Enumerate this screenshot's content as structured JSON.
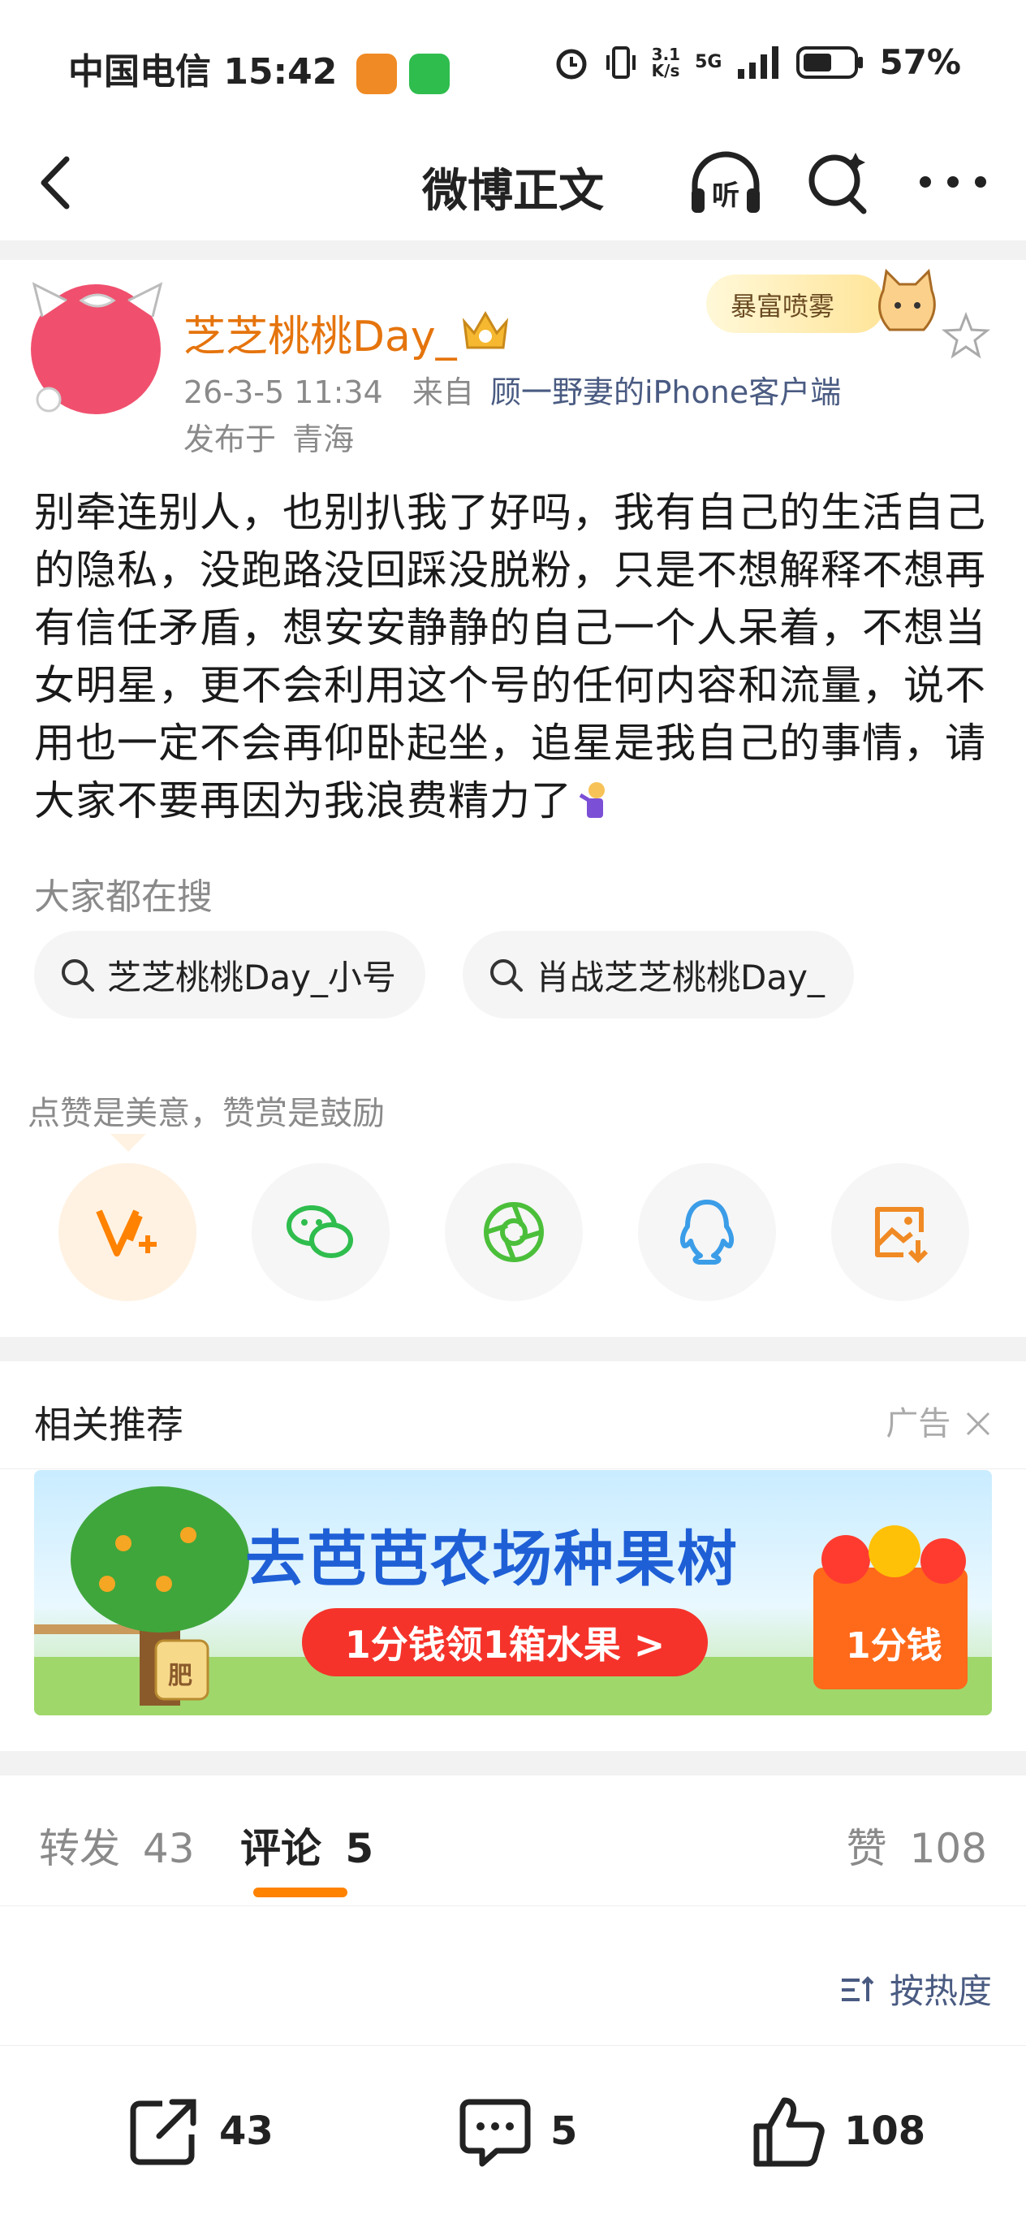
{
  "status_bar": {
    "carrier": "中国电信",
    "time": "15:42",
    "net_speed_top": "3.1",
    "net_speed_bottom": "K/s",
    "network": "5G",
    "battery": "57%"
  },
  "nav": {
    "title": "微博正文"
  },
  "author": {
    "name": "芝芝桃桃Day_",
    "date": "26-3-5 11:34",
    "from_label": "来自",
    "source": "顾一野妻的iPhone客户端",
    "location_label": "发布于",
    "location": "青海",
    "decoration_text": "暴富喷雾"
  },
  "post": {
    "text": "别牵连别人，也别扒我了好吗，我有自己的生活自己的隐私，没跑路没回踩没脱粉，只是不想解释不想再有信任矛盾，想安安静静的自己一个人呆着，不想当女明星，更不会利用这个号的任何内容和流量，说不用也一定不会再仰卧起坐，追星是我自己的事情，请大家不要再因为我浪费精力了"
  },
  "hot_search": {
    "label": "大家都在搜",
    "items": [
      "芝芝桃桃Day_小号",
      "肖战芝芝桃桃Day_"
    ]
  },
  "reward": {
    "hint": "点赞是美意，赞赏是鼓励"
  },
  "share_icons": [
    "reward-v-icon",
    "wechat-icon",
    "moments-icon",
    "qq-icon",
    "save-image-icon"
  ],
  "recommend": {
    "title": "相关推荐",
    "ad_label": "广告",
    "banner_title": "去芭芭农场种果树",
    "banner_button": "1分钱领1箱水果 >",
    "banner_badge": "1分钱",
    "banner_small": "肥"
  },
  "tabs": {
    "repost_label": "转发",
    "repost_count": "43",
    "comment_label": "评论",
    "comment_count": "5",
    "like_label": "赞",
    "like_count": "108"
  },
  "sort": {
    "label": "按热度"
  },
  "toolbar": {
    "repost": "43",
    "comment": "5",
    "like": "108"
  },
  "colors": {
    "accent": "#ff8200",
    "username": "#e5740d",
    "link": "#4a5b82"
  }
}
